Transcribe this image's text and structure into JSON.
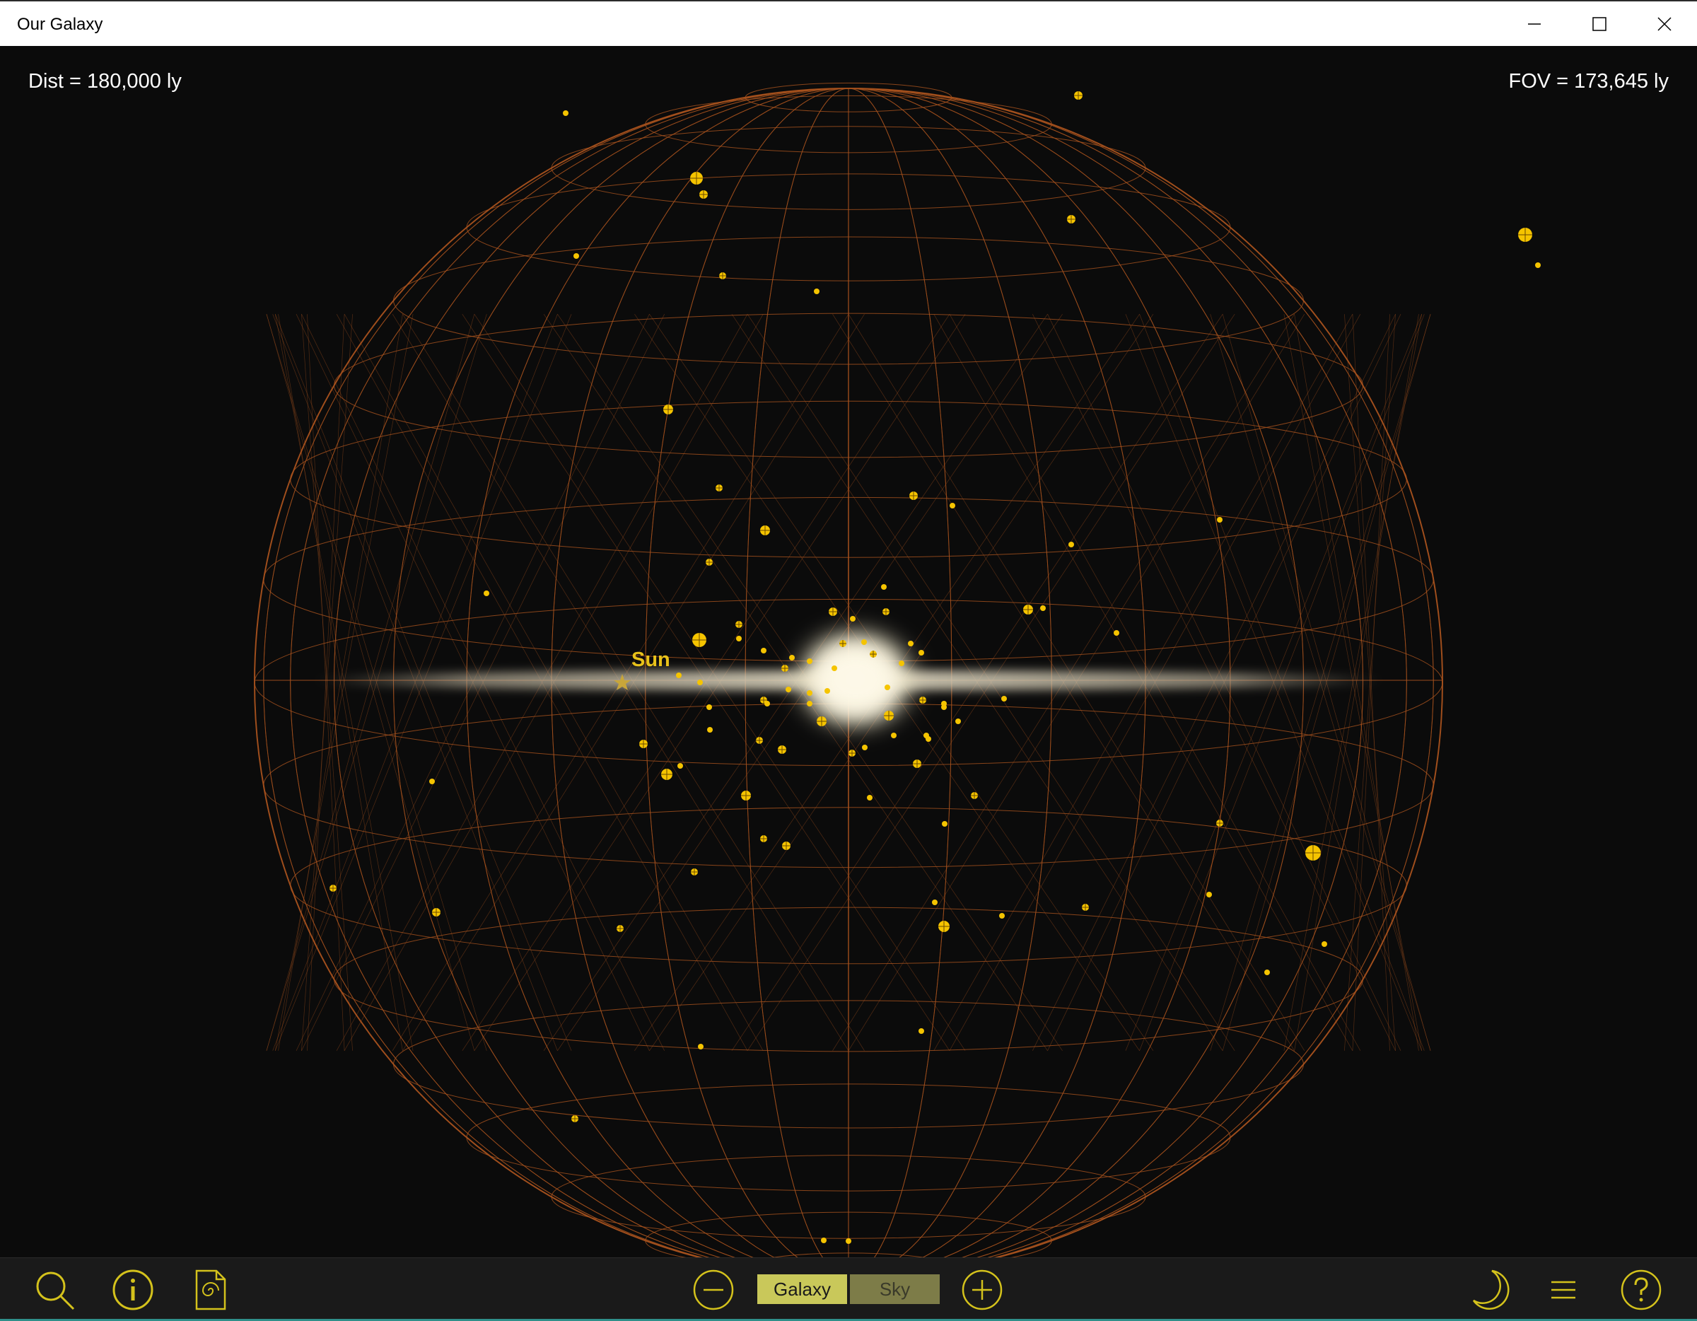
{
  "window": {
    "title": "Our Galaxy"
  },
  "hud": {
    "distance": "Dist = 180,000 ly",
    "fov": "FOV = 173,645 ly"
  },
  "labels": {
    "sun": "Sun"
  },
  "toolbar": {
    "modes": [
      {
        "label": "Galaxy",
        "selected": true
      },
      {
        "label": "Sky",
        "selected": false
      }
    ]
  },
  "icons": [
    "search-icon",
    "info-icon",
    "galaxy-document-icon",
    "zoom-out-icon",
    "zoom-in-icon",
    "night-mode-icon",
    "menu-icon",
    "help-icon"
  ],
  "colors": {
    "grid": "#a8521e",
    "accent": "#e8c020",
    "cluster": "#f5c400"
  }
}
